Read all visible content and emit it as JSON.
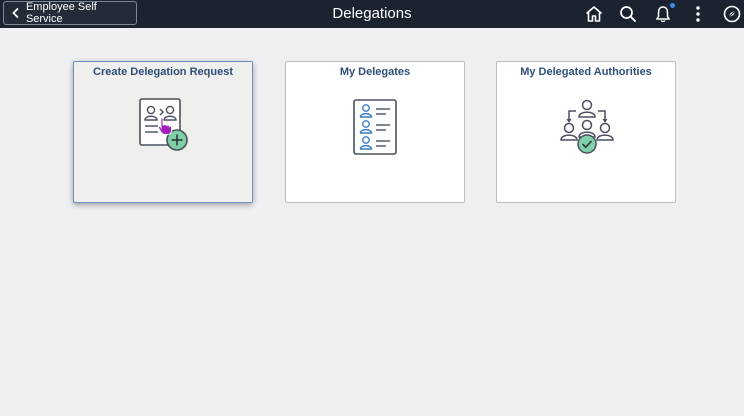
{
  "header": {
    "back_label": "Employee Self Service",
    "title": "Delegations",
    "icons": [
      "home-icon",
      "search-icon",
      "notifications-icon",
      "actions-menu-icon",
      "navbar-icon"
    ],
    "notification_indicator_color": "#3c8ee8",
    "background_color": "#1b2230"
  },
  "tiles": [
    {
      "title": "Create Delegation Request",
      "icon": "create-delegation-icon",
      "state": "hovered"
    },
    {
      "title": "My Delegates",
      "icon": "delegates-list-icon"
    },
    {
      "title": "My Delegated Authorities",
      "icon": "delegated-authorities-icon"
    }
  ],
  "colors": {
    "tile_title": "#2e4f7a",
    "icon_accent": "#7fcfa7",
    "cursor": "#a321b8"
  }
}
